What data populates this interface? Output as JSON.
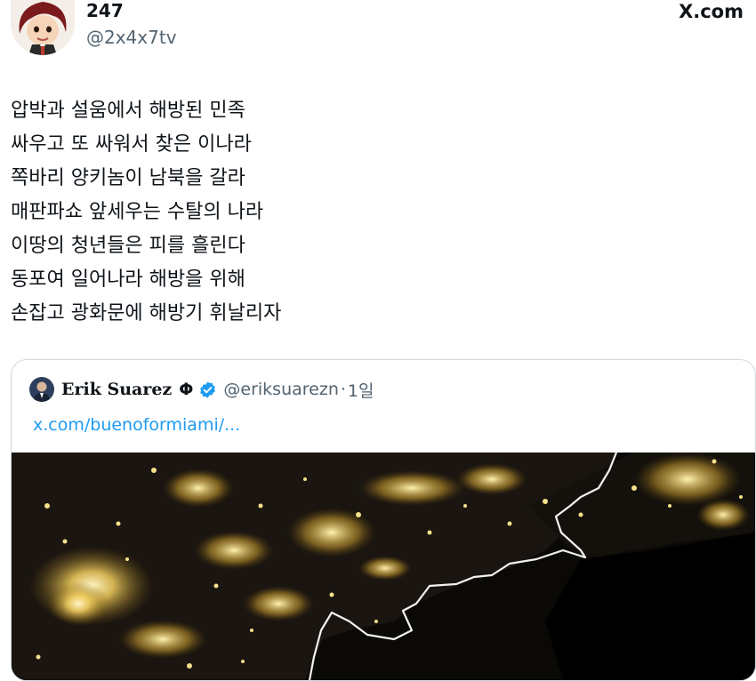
{
  "tweet": {
    "display_name": "247",
    "handle": "@2x4x7tv",
    "brand": "X.com",
    "body_lines": [
      "압박과 설움에서 해방된 민족",
      "싸우고 또 싸워서 찾은 이나라",
      "쪽바리 양키놈이 남북을 갈라",
      "매판파쇼 앞세우는 수탈의 나라",
      "이땅의 청년들은 피를 흘린다",
      "동포여 일어나라 해방을 위해",
      "손잡고 광화문에 해방기 휘날리자"
    ]
  },
  "quoted": {
    "name": "Erik Suarez",
    "symbol": "Φ",
    "handle": "@eriksuarezn",
    "separator": "·",
    "time": "1일",
    "link": "x.com/buenoformiami/...",
    "verified_color": "#1d9bf0"
  },
  "colors": {
    "text": "#0f1419",
    "secondary": "#536471",
    "link": "#1d9bf0",
    "border": "#cfd9de"
  }
}
